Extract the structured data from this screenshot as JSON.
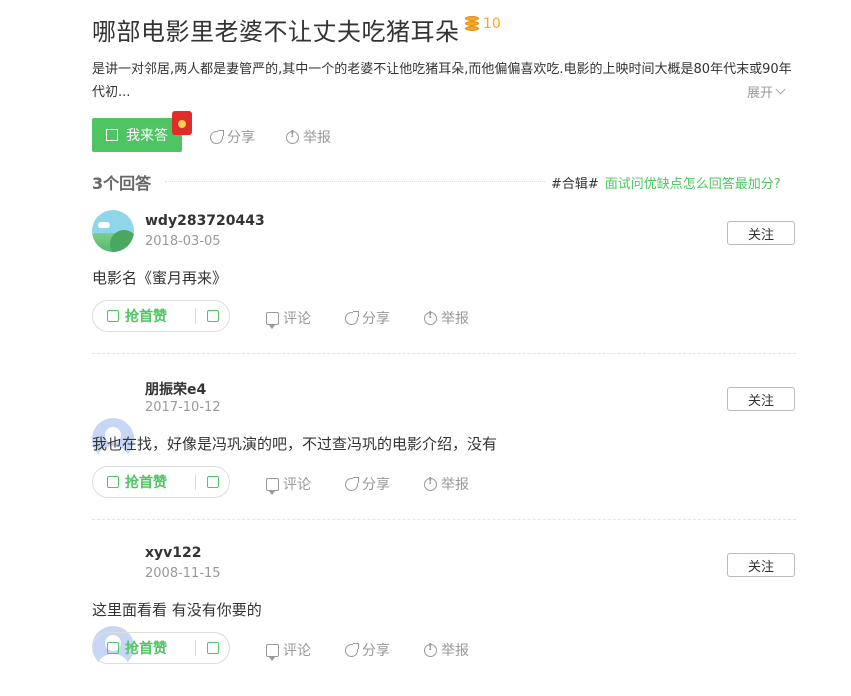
{
  "question": {
    "title": "哪部电影里老婆不让丈夫吃猪耳朵",
    "reward": "10",
    "description": "是讲一对邻居,两人都是妻管严的,其中一个的老婆不让他吃猪耳朵,而他偏偏喜欢吃.电影的上映时间大概是80年代末或90年代初...",
    "expand_label": "展开",
    "answer_button": "我来答",
    "share_label": "分享",
    "report_label": "举报"
  },
  "answers_header": {
    "count": "3个回答",
    "collection_tag": "#合辑#",
    "collection_question": "面试问优缺点怎么回答最加分?"
  },
  "answers": [
    {
      "user": "wdy283720443",
      "date": "2018-03-05",
      "content": "电影名《蜜月再来》",
      "avatar": "landscape-avatar",
      "follow": "关注",
      "upvote": "抢首赞",
      "comment": "评论",
      "share": "分享",
      "report": "举报"
    },
    {
      "user": "朋振荣e4",
      "date": "2017-10-12",
      "content": "我也在找，好像是冯巩演的吧，不过查冯巩的电影介绍，没有",
      "avatar": "default-avatar",
      "follow": "关注",
      "upvote": "抢首赞",
      "comment": "评论",
      "share": "分享",
      "report": "举报"
    },
    {
      "user": "xyv122",
      "date": "2008-11-15",
      "content": "这里面看看 有没有你要的",
      "avatar": "default-avatar",
      "follow": "关注",
      "upvote": "抢首赞",
      "comment": "评论",
      "share": "分享",
      "report": "举报"
    }
  ],
  "colors": {
    "accent": "#4fc462",
    "coin": "#f5a623",
    "muted": "#999999"
  }
}
